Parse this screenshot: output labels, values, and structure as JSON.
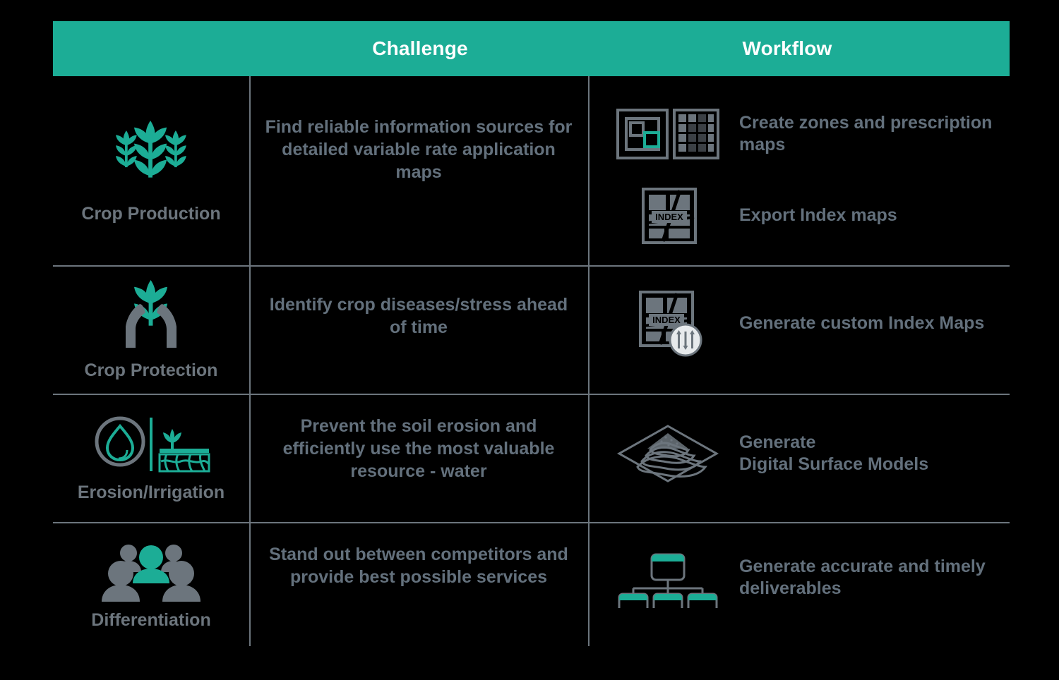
{
  "header": {
    "category_column": "",
    "challenge_label": "Challenge",
    "workflow_label": "Workflow"
  },
  "colors": {
    "accent_teal": "#1CAD96",
    "text_gray": "#63707C",
    "divider_gray": "#6C757D",
    "background": "#000000",
    "header_text": "#FFFFFF"
  },
  "rows": [
    {
      "category": "Crop Production",
      "category_icon": "wheat-stalks-icon",
      "challenge": "Find reliable information sources for detailed variable rate application maps",
      "workflows": [
        {
          "icon": "zones-and-prescription-maps-icon",
          "text": "Create zones and prescription maps"
        },
        {
          "icon": "index-map-icon",
          "text": "Export Index maps"
        }
      ]
    },
    {
      "category": "Crop Protection",
      "category_icon": "hands-holding-plant-icon",
      "challenge": "Identify crop diseases/stress ahead of time",
      "workflows": [
        {
          "icon": "index-map-settings-icon",
          "text": "Generate custom Index Maps"
        }
      ]
    },
    {
      "category": "Erosion/Irrigation",
      "category_icon": "water-drop-and-soil-icon",
      "challenge": "Prevent the soil erosion and efficiently use the most valuable resource - water",
      "workflows": [
        {
          "icon": "digital-surface-model-icon",
          "text": "Generate\nDigital Surface Models"
        }
      ]
    },
    {
      "category": "Differentiation",
      "category_icon": "people-group-icon",
      "challenge": "Stand out between competitors and provide best possible services",
      "workflows": [
        {
          "icon": "hierarchy-chart-icon",
          "text": "Generate accurate and timely deliverables"
        }
      ]
    }
  ],
  "icon_labels": {
    "index_badge": "INDEX"
  }
}
